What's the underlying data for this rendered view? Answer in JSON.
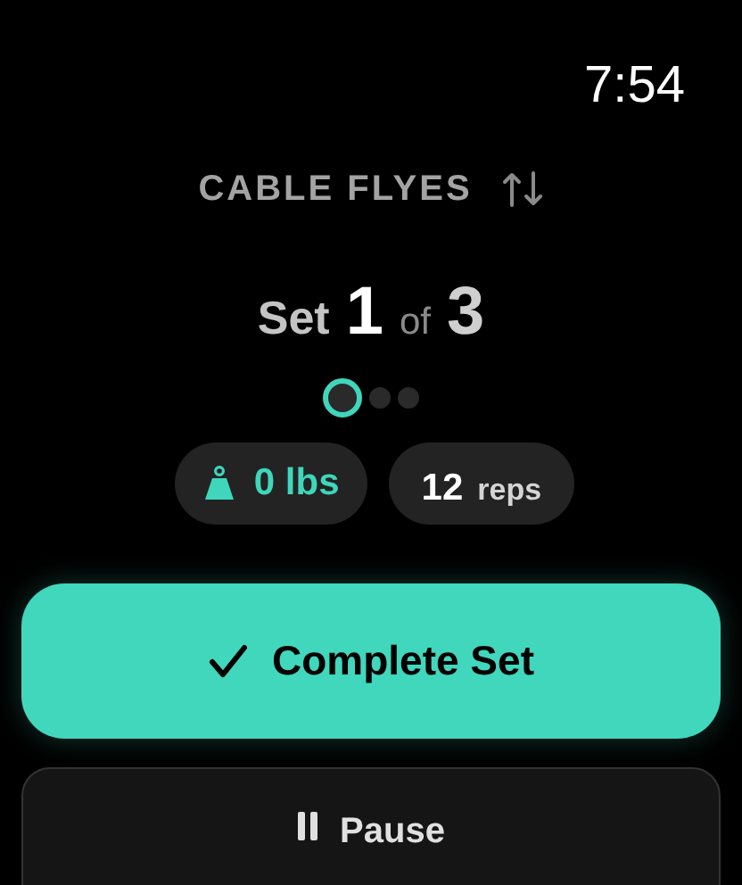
{
  "status_bar": {
    "time": "7:54"
  },
  "exercise": {
    "name": "CABLE FLYES"
  },
  "set_counter": {
    "label": "Set",
    "current": "1",
    "separator": "of",
    "total": "3"
  },
  "set_dots": [
    {
      "selected": true
    },
    {
      "selected": false
    },
    {
      "selected": false
    }
  ],
  "chips": [
    {
      "kind": "weight",
      "value": "0 lbs"
    },
    {
      "kind": "reps",
      "value": "12",
      "unit": "reps"
    }
  ],
  "buttons": [
    {
      "kind": "primary",
      "label": "Complete Set"
    },
    {
      "kind": "secondary",
      "label": "Pause"
    }
  ]
}
